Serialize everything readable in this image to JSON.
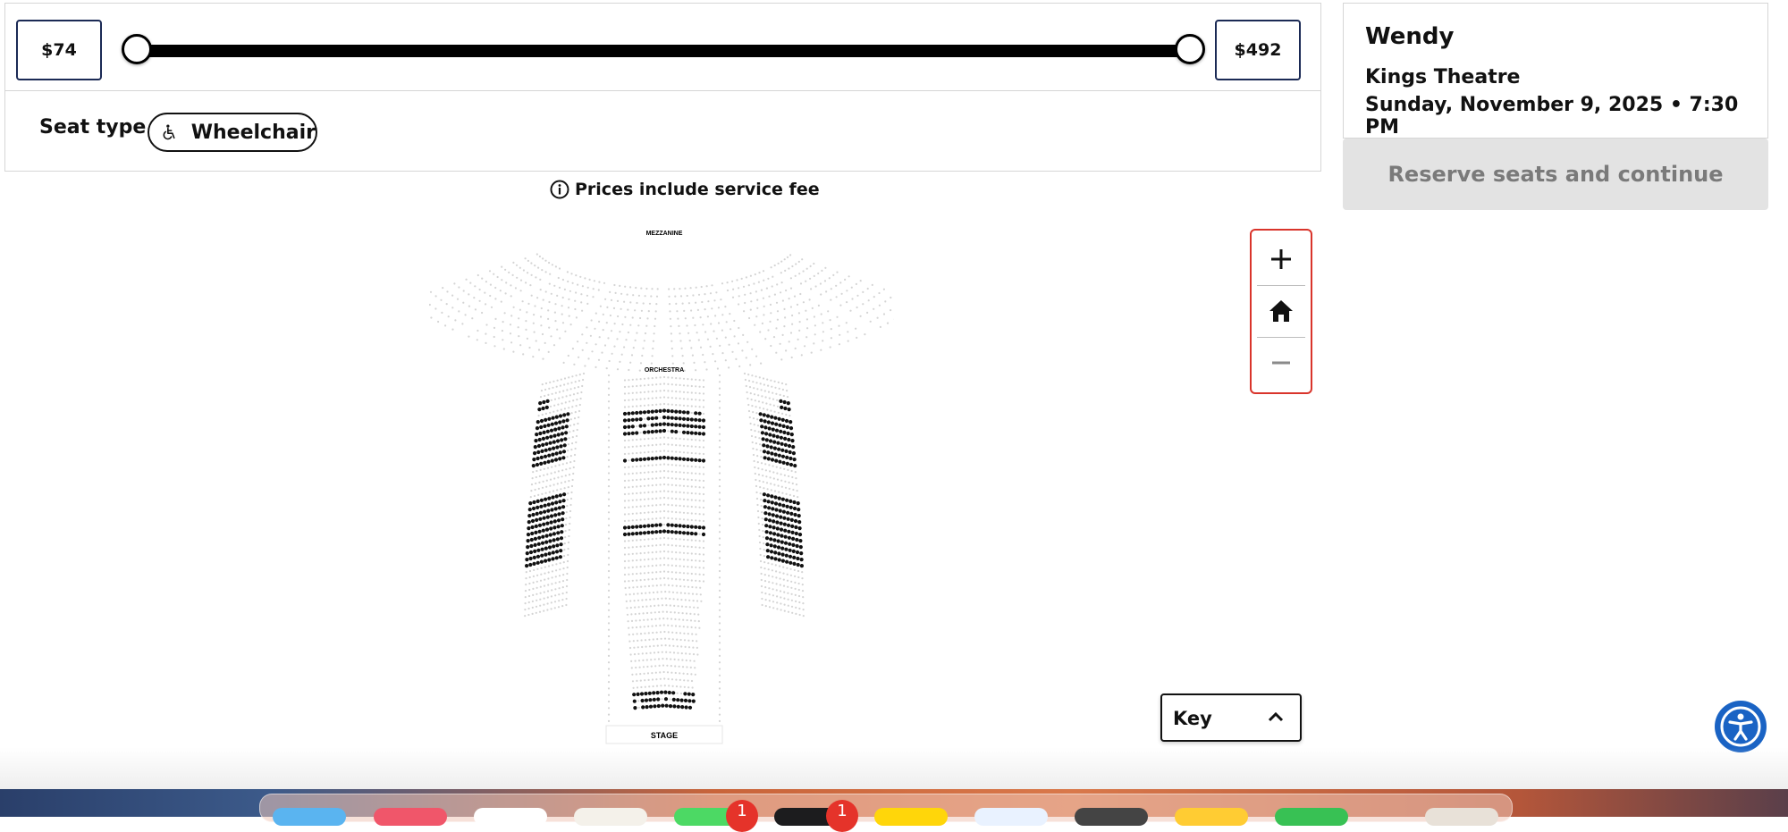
{
  "price_filter": {
    "min_label": "$74",
    "max_label": "$492",
    "selected_min_fraction": 0.0,
    "selected_max_fraction": 1.0
  },
  "seat_type": {
    "label": "Seat type",
    "chip_label": "Wheelchair",
    "chip_icon": "wheelchair-icon"
  },
  "price_note": {
    "icon": "info-icon",
    "text": "Prices include service fee"
  },
  "event": {
    "title": "Wendy",
    "venue": "Kings Theatre",
    "datetime": "Sunday, November 9, 2025 • 7:30 PM"
  },
  "reserve_button": {
    "label": "Reserve seats and continue",
    "enabled": false
  },
  "seat_map": {
    "sections": {
      "mezzanine": "MEZZANINE",
      "orchestra": "ORCHESTRA",
      "stage": "STAGE"
    }
  },
  "zoom_controls": {
    "zoom_in_icon": "plus-icon",
    "home_icon": "home-icon",
    "zoom_out_icon": "minus-icon"
  },
  "key": {
    "label": "Key",
    "icon": "chevron-up-icon"
  },
  "accessibility": {
    "icon": "accessibility-icon"
  },
  "dock": {
    "badges": [
      "1",
      "1"
    ]
  },
  "colors": {
    "accent_border": "#1b2a55",
    "zoom_border": "#d9342b",
    "accessibility_blue": "#1a63c4",
    "disabled_button": "#e3e3e3"
  }
}
